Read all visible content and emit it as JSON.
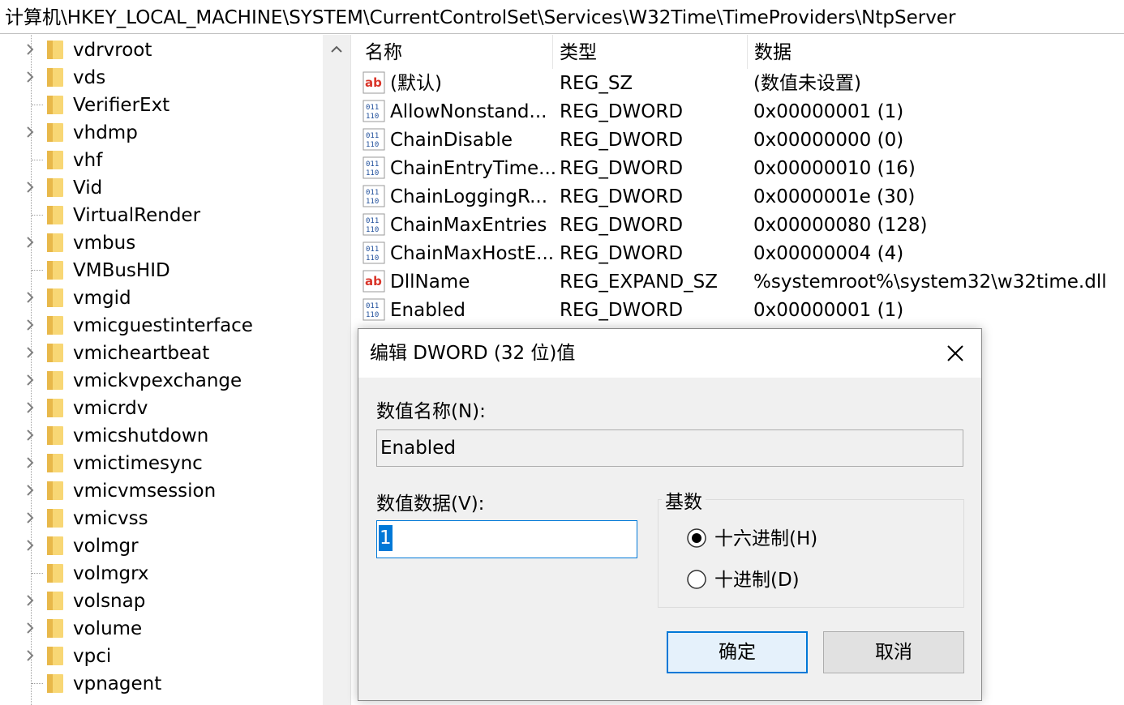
{
  "address_bar": {
    "path": "计算机\\HKEY_LOCAL_MACHINE\\SYSTEM\\CurrentControlSet\\Services\\W32Time\\TimeProviders\\NtpServer"
  },
  "tree": {
    "items": [
      {
        "label": "vdrvroot",
        "expandable": true
      },
      {
        "label": "vds",
        "expandable": true
      },
      {
        "label": "VerifierExt",
        "expandable": false
      },
      {
        "label": "vhdmp",
        "expandable": true
      },
      {
        "label": "vhf",
        "expandable": false
      },
      {
        "label": "Vid",
        "expandable": true
      },
      {
        "label": "VirtualRender",
        "expandable": false
      },
      {
        "label": "vmbus",
        "expandable": true
      },
      {
        "label": "VMBusHID",
        "expandable": false
      },
      {
        "label": "vmgid",
        "expandable": true
      },
      {
        "label": "vmicguestinterface",
        "expandable": true
      },
      {
        "label": "vmicheartbeat",
        "expandable": true
      },
      {
        "label": "vmickvpexchange",
        "expandable": true
      },
      {
        "label": "vmicrdv",
        "expandable": true
      },
      {
        "label": "vmicshutdown",
        "expandable": true
      },
      {
        "label": "vmictimesync",
        "expandable": true
      },
      {
        "label": "vmicvmsession",
        "expandable": true
      },
      {
        "label": "vmicvss",
        "expandable": true
      },
      {
        "label": "volmgr",
        "expandable": true
      },
      {
        "label": "volmgrx",
        "expandable": false
      },
      {
        "label": "volsnap",
        "expandable": true
      },
      {
        "label": "volume",
        "expandable": true
      },
      {
        "label": "vpci",
        "expandable": true
      },
      {
        "label": "vpnagent",
        "expandable": false
      }
    ]
  },
  "list": {
    "columns": {
      "name": "名称",
      "type": "类型",
      "data": "数据"
    },
    "rows": [
      {
        "icon": "string-value-icon",
        "name": "(默认)",
        "type": "REG_SZ",
        "data": "(数值未设置)"
      },
      {
        "icon": "dword-value-icon",
        "name": "AllowNonstand...",
        "type": "REG_DWORD",
        "data": "0x00000001 (1)"
      },
      {
        "icon": "dword-value-icon",
        "name": "ChainDisable",
        "type": "REG_DWORD",
        "data": "0x00000000 (0)"
      },
      {
        "icon": "dword-value-icon",
        "name": "ChainEntryTime...",
        "type": "REG_DWORD",
        "data": "0x00000010 (16)"
      },
      {
        "icon": "dword-value-icon",
        "name": "ChainLoggingR...",
        "type": "REG_DWORD",
        "data": "0x0000001e (30)"
      },
      {
        "icon": "dword-value-icon",
        "name": "ChainMaxEntries",
        "type": "REG_DWORD",
        "data": "0x00000080 (128)"
      },
      {
        "icon": "dword-value-icon",
        "name": "ChainMaxHostE...",
        "type": "REG_DWORD",
        "data": "0x00000004 (4)"
      },
      {
        "icon": "string-value-icon",
        "name": "DllName",
        "type": "REG_EXPAND_SZ",
        "data": "%systemroot%\\system32\\w32time.dll"
      },
      {
        "icon": "dword-value-icon",
        "name": "Enabled",
        "type": "REG_DWORD",
        "data": "0x00000001 (1)"
      }
    ]
  },
  "dialog": {
    "title": "编辑 DWORD (32 位)值",
    "value_name_label": "数值名称(N):",
    "value_name": "Enabled",
    "value_data_label": "数值数据(V):",
    "value_data": "1",
    "base_label": "基数",
    "base_options": {
      "hex": "十六进制(H)",
      "dec": "十进制(D)"
    },
    "base_selected": "hex",
    "ok_label": "确定",
    "cancel_label": "取消"
  },
  "colors": {
    "accent": "#0078d7",
    "folder": "#f8d775",
    "dialog_bg": "#f0f0f0"
  }
}
